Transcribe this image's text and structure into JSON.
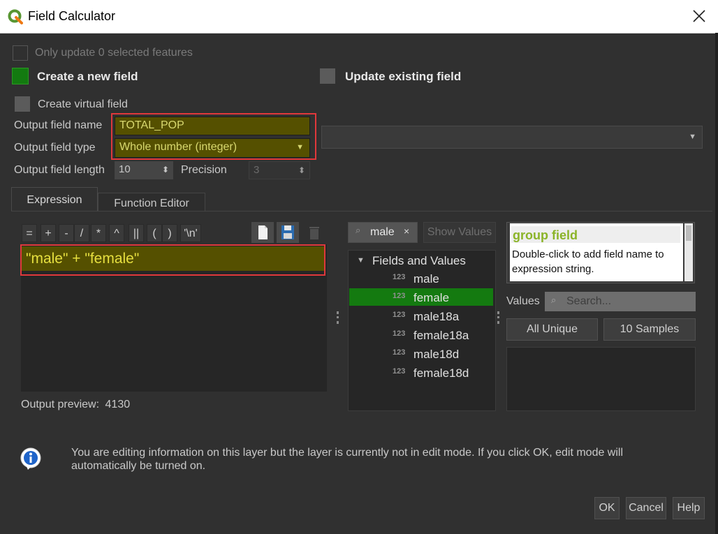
{
  "window": {
    "title": "Field Calculator",
    "close_glyph": "✕"
  },
  "options": {
    "only_update_selected": "Only update 0 selected features",
    "create_new_field": "Create a new field",
    "update_existing_field": "Update existing field",
    "create_virtual_field": "Create virtual field"
  },
  "output": {
    "name_label": "Output field name",
    "name_value": "TOTAL_POP",
    "type_label": "Output field type",
    "type_value": "Whole number (integer)",
    "length_label": "Output field length",
    "length_value": "10",
    "precision_label": "Precision",
    "precision_value": "3"
  },
  "tabs": [
    {
      "label": "Expression"
    },
    {
      "label": "Function Editor"
    }
  ],
  "operators": [
    "=",
    "+",
    "-",
    "/",
    "*",
    "^",
    "||",
    "(",
    ")",
    "'\\n'"
  ],
  "expression": {
    "text": "\"male\" + \"female\""
  },
  "preview": {
    "label": "Output preview:",
    "value": "4130"
  },
  "search": {
    "value": "male",
    "clear_glyph": "×",
    "show_values": "Show Values"
  },
  "tree": {
    "group": "Fields and Values",
    "type_icon": "123",
    "items": [
      {
        "label": "male"
      },
      {
        "label": "female",
        "selected": true
      },
      {
        "label": "male18a"
      },
      {
        "label": "female18a"
      },
      {
        "label": "male18d"
      },
      {
        "label": "female18d"
      }
    ]
  },
  "help": {
    "title": "group field",
    "text": "Double-click to add field name to expression string."
  },
  "values": {
    "label": "Values",
    "search_placeholder": "Search...",
    "all_unique": "All Unique",
    "samples": "10 Samples"
  },
  "info": {
    "icon": "info-icon",
    "message": "You are editing information on this layer but the layer is currently not in edit mode. If you click OK, edit mode will automatically be turned on."
  },
  "buttons": {
    "ok": "OK",
    "cancel": "Cancel",
    "help": "Help"
  },
  "colors": {
    "accent_green": "#137a10",
    "expression_bg": "#555000",
    "highlight_red": "#e0383b",
    "help_title": "#8bb428"
  }
}
